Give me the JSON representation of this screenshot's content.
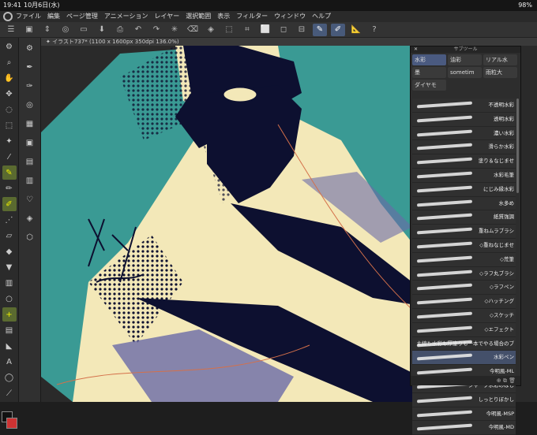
{
  "status": {
    "time": "19:41",
    "date": "10月6日(水)",
    "battery": "98%"
  },
  "menu": [
    "ファイル",
    "編集",
    "ページ管理",
    "アニメーション",
    "レイヤー",
    "選択範囲",
    "表示",
    "フィルター",
    "ウィンドウ",
    "ヘルプ"
  ],
  "tab": {
    "title": "✦ イラスト737* (1100 x 1600px 350dpi 136.0%)"
  },
  "panel": {
    "title": "サブツール",
    "cats": [
      "水彩",
      "油彩",
      "リアル水",
      "墨",
      "sometim",
      "雨粒大",
      "ダイヤモ"
    ],
    "items": [
      "不透明水彩",
      "透明水彩",
      "濃い水彩",
      "滑らか水彩",
      "塗り＆なじませ",
      "水彩毛筆",
      "にじみ縁水彩",
      "水多め",
      "紙質強調",
      "重ねムラブラシ",
      "◇重ねなじませ",
      "◇荒筆",
      "◇ラフ丸ブラシ",
      "◇ラフペン",
      "◇ハッチング",
      "◇スケッチ",
      "◇エフェクト",
      "主線も水彩も厚塗りも一本でやる場合のブ",
      "水彩ペン",
      "今明風-ML",
      "シャープ水彩のばし",
      "しっとりぼかし",
      "今明風-MSP",
      "今明風-MD"
    ],
    "selected_index": 18
  },
  "colors": {
    "teal": "#3a9a94",
    "cream": "#f3e8b8",
    "ink": "#0d1030",
    "purple": "#6a6aa8",
    "orange": "#d4704a"
  }
}
